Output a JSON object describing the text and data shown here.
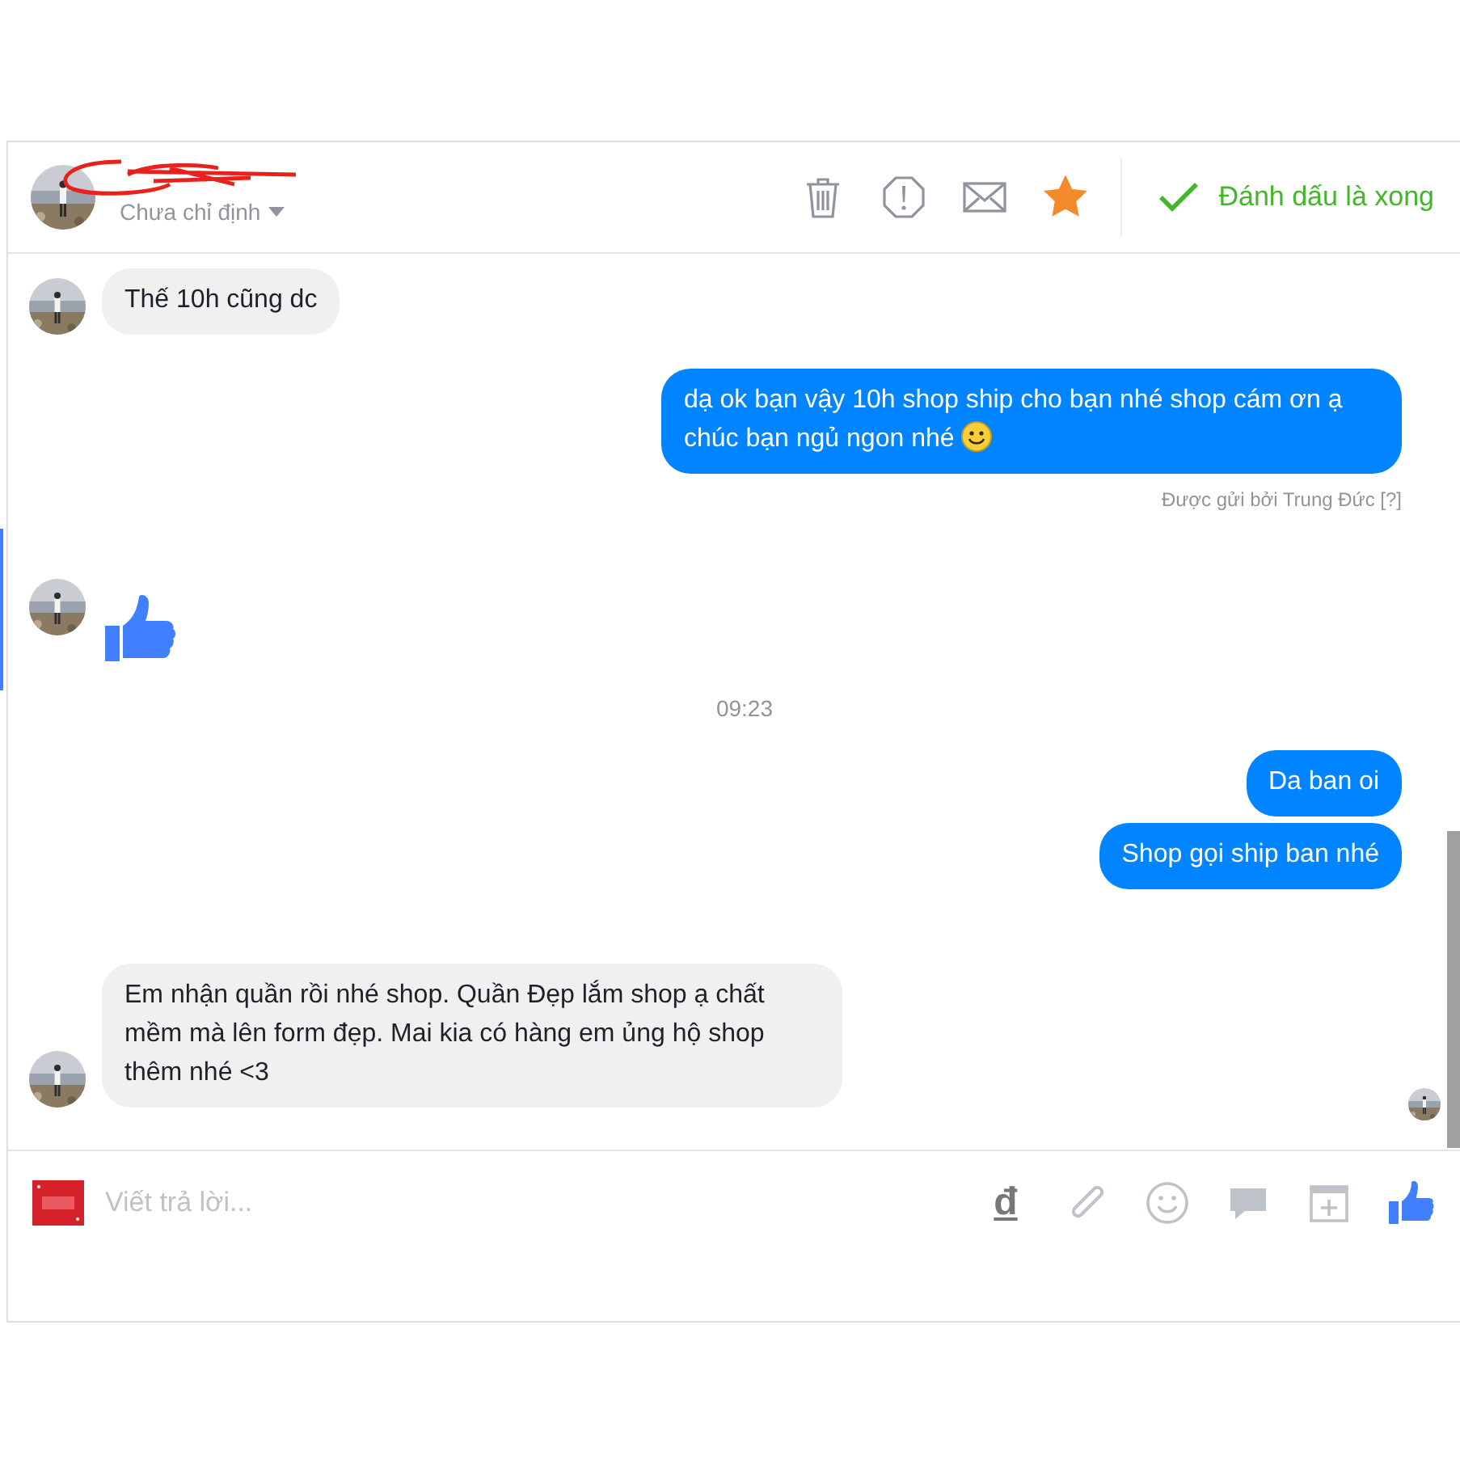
{
  "header": {
    "subtitle": "Chưa chỉ định",
    "starred": true,
    "done_label": "Đánh dấu là xong"
  },
  "messages": [
    {
      "kind": "text",
      "outgoing": false,
      "text": "Thế 10h cũng dc"
    },
    {
      "kind": "text",
      "outgoing": true,
      "text": "dạ ok bạn vậy 10h shop ship cho bạn nhé shop cám ơn ạ chúc bạn ngủ ngon nhé",
      "emoji": true
    },
    {
      "kind": "note",
      "text": "Được gửi bởi Trung Đức [?]"
    },
    {
      "kind": "like",
      "outgoing": false
    },
    {
      "kind": "time",
      "text": "09:23"
    },
    {
      "kind": "text",
      "outgoing": true,
      "text": "Da ban oi"
    },
    {
      "kind": "text",
      "outgoing": true,
      "text": "Shop gọi ship ban nhé"
    },
    {
      "kind": "text",
      "outgoing": false,
      "text": "Em nhận quần rồi nhé shop. Quần Đẹp lắm shop ạ chất mềm mà lên form đẹp. Mai kia có hàng em ủng hộ shop thêm nhé <3"
    }
  ],
  "composer": {
    "placeholder": "Viết trả lời...",
    "currency_symbol": "đ"
  }
}
